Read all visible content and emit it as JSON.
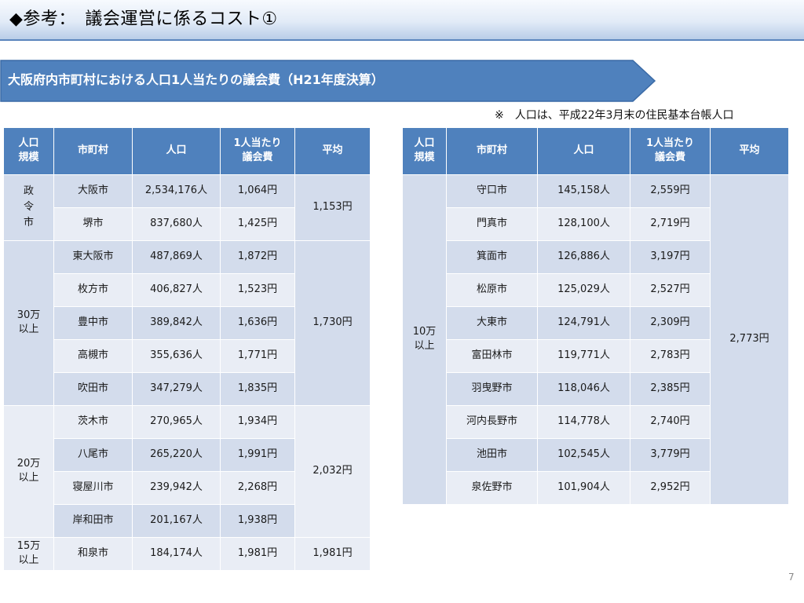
{
  "title": "◆参考：　議会運営に係るコスト①",
  "banner": "大阪府内市町村における人口1人当たりの議会費（H21年度決算）",
  "note": "※　人口は、平成22年3月末の住民基本台帳人口",
  "headers": [
    "人口規模",
    "市町村",
    "人口",
    "1人当たり議会費",
    "平均"
  ],
  "left_table": {
    "groups": [
      {
        "size": "政令市",
        "average": "1,153円",
        "rows": [
          {
            "city": "大阪市",
            "population": "2,534,176人",
            "per_capita": "1,064円"
          },
          {
            "city": "堺市",
            "population": "837,680人",
            "per_capita": "1,425円"
          }
        ]
      },
      {
        "size": "30万以上",
        "average": "1,730円",
        "rows": [
          {
            "city": "東大阪市",
            "population": "487,869人",
            "per_capita": "1,872円"
          },
          {
            "city": "枚方市",
            "population": "406,827人",
            "per_capita": "1,523円"
          },
          {
            "city": "豊中市",
            "population": "389,842人",
            "per_capita": "1,636円"
          },
          {
            "city": "高槻市",
            "population": "355,636人",
            "per_capita": "1,771円"
          },
          {
            "city": "吹田市",
            "population": "347,279人",
            "per_capita": "1,835円"
          }
        ]
      },
      {
        "size": "20万以上",
        "average": "2,032円",
        "rows": [
          {
            "city": "茨木市",
            "population": "270,965人",
            "per_capita": "1,934円"
          },
          {
            "city": "八尾市",
            "population": "265,220人",
            "per_capita": "1,991円"
          },
          {
            "city": "寝屋川市",
            "population": "239,942人",
            "per_capita": "2,268円"
          },
          {
            "city": "岸和田市",
            "population": "201,167人",
            "per_capita": "1,938円"
          }
        ]
      },
      {
        "size": "15万以上",
        "average": "1,981円",
        "rows": [
          {
            "city": "和泉市",
            "population": "184,174人",
            "per_capita": "1,981円"
          }
        ]
      }
    ]
  },
  "right_table": {
    "groups": [
      {
        "size": "10万以上",
        "average": "2,773円",
        "rows": [
          {
            "city": "守口市",
            "population": "145,158人",
            "per_capita": "2,559円"
          },
          {
            "city": "門真市",
            "population": "128,100人",
            "per_capita": "2,719円"
          },
          {
            "city": "箕面市",
            "population": "126,886人",
            "per_capita": "3,197円"
          },
          {
            "city": "松原市",
            "population": "125,029人",
            "per_capita": "2,527円"
          },
          {
            "city": "大東市",
            "population": "124,791人",
            "per_capita": "2,309円"
          },
          {
            "city": "富田林市",
            "population": "119,771人",
            "per_capita": "2,783円"
          },
          {
            "city": "羽曳野市",
            "population": "118,046人",
            "per_capita": "2,385円"
          },
          {
            "city": "河内長野市",
            "population": "114,778人",
            "per_capita": "2,740円"
          },
          {
            "city": "池田市",
            "population": "102,545人",
            "per_capita": "3,779円"
          },
          {
            "city": "泉佐野市",
            "population": "101,904人",
            "per_capita": "2,952円"
          }
        ]
      }
    ]
  },
  "page_number": "7",
  "colors": {
    "header": "#4f81bd",
    "row_dark": "#d3dcec",
    "row_light": "#e9edf5",
    "banner": "#4f81bd"
  }
}
